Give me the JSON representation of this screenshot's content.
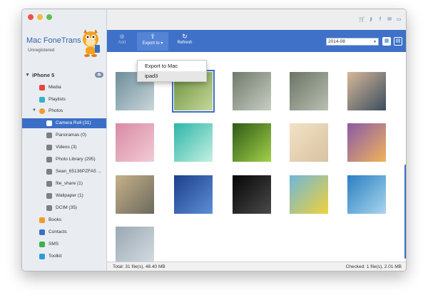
{
  "app": {
    "name": "Mac FoneTrans",
    "status": "Unregistered"
  },
  "device": {
    "name": "iPhone 5"
  },
  "sidebar": {
    "items": [
      {
        "label": "Media",
        "icon": "music-icon",
        "color": "#e8453c"
      },
      {
        "label": "Playlists",
        "icon": "playlist-icon",
        "color": "#2fb4c9"
      },
      {
        "label": "Photos",
        "icon": "photos-icon",
        "color": "#f29b2a"
      },
      {
        "label": "Books",
        "icon": "books-icon",
        "color": "#f29b2a"
      },
      {
        "label": "Contacts",
        "icon": "contacts-icon",
        "color": "#3b6fc7"
      },
      {
        "label": "SMS",
        "icon": "sms-icon",
        "color": "#3db24a"
      },
      {
        "label": "Toolkit",
        "icon": "toolkit-icon",
        "color": "#2f9bd6"
      }
    ],
    "photo_albums": [
      {
        "label": "Camera Roll (31)",
        "selected": true
      },
      {
        "label": "Panoramas (0)"
      },
      {
        "label": "Videos (3)"
      },
      {
        "label": "Photo Library (295)"
      },
      {
        "label": "Sean_65136PZFA5 ..."
      },
      {
        "label": "file_share (1)"
      },
      {
        "label": "Wallpaper (1)"
      },
      {
        "label": "DCIM (35)"
      }
    ]
  },
  "toolbar": {
    "add_label": "Add",
    "export_label": "Export to",
    "refresh_label": "Refresh",
    "date_value": "2014-08"
  },
  "export_menu": {
    "items": [
      "Export to Mac",
      "ipad3"
    ]
  },
  "photos": [
    {
      "colors": [
        "#6d8e9a",
        "#c9d6da"
      ]
    },
    {
      "colors": [
        "#6a8f3c",
        "#c6d99a"
      ]
    },
    {
      "colors": [
        "#707a6a",
        "#c8cec4"
      ]
    },
    {
      "colors": [
        "#6b7466",
        "#b9c0b2"
      ]
    },
    {
      "colors": [
        "#d7b79a",
        "#3a4e5e"
      ]
    },
    {
      "colors": [
        "#d98aa4",
        "#f2cbd6"
      ]
    },
    {
      "colors": [
        "#2bb6a7",
        "#c5f0e3"
      ]
    },
    {
      "colors": [
        "#2e5a16",
        "#a3d04a"
      ]
    },
    {
      "colors": [
        "#f1e2c6",
        "#d8c2a0"
      ]
    },
    {
      "colors": [
        "#8a5aa8",
        "#f0b35a"
      ]
    },
    {
      "colors": [
        "#c6b08a",
        "#6b6a5c"
      ]
    },
    {
      "colors": [
        "#1d3f8a",
        "#5c8fd6"
      ]
    },
    {
      "colors": [
        "#050505",
        "#4a4a4a"
      ]
    },
    {
      "colors": [
        "#6fb6d9",
        "#f0d23a"
      ]
    },
    {
      "colors": [
        "#2a7fc0",
        "#a9d6ef"
      ]
    },
    {
      "colors": [
        "#9aa8b2",
        "#d6dde2"
      ]
    }
  ],
  "status": {
    "total": "Total: 31 file(s), 48.40 MB",
    "checked": "Checked: 1 file(s), 2.01 MB"
  },
  "colors": {
    "accent": "#3f71c8",
    "selection": "#3b6fc7"
  }
}
